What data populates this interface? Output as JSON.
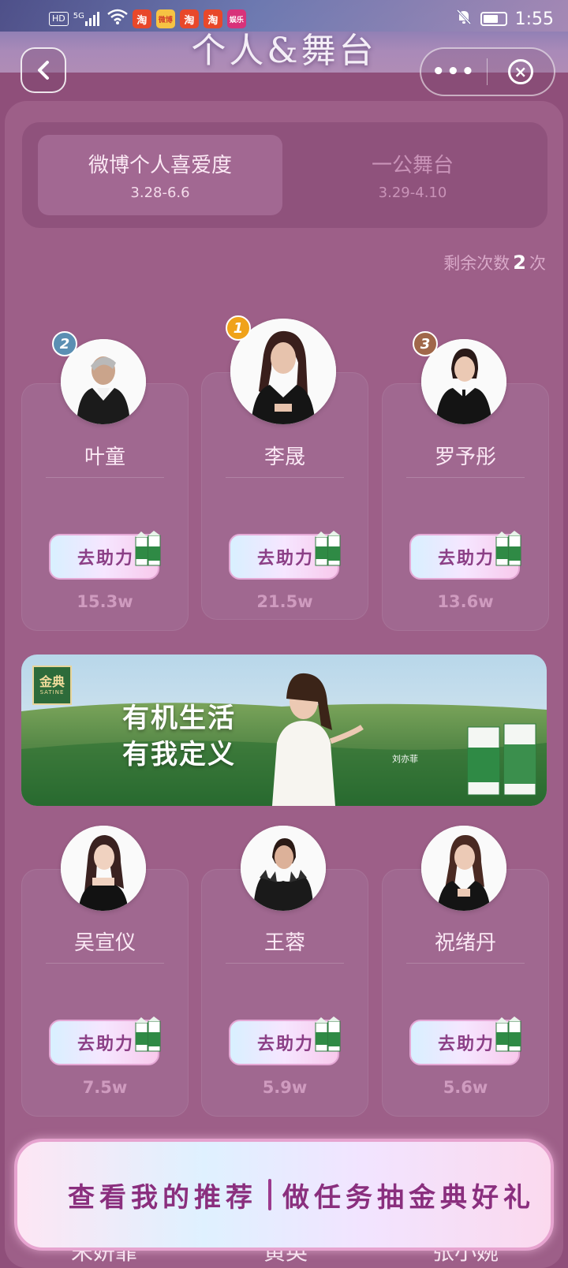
{
  "status_bar": {
    "network_chip": "HD",
    "signal": "5G",
    "time": "1:55",
    "apps": [
      "淘",
      "微博",
      "淘",
      "淘",
      "娱乐"
    ]
  },
  "header": {
    "banner_title": "个人&舞台"
  },
  "tabs": [
    {
      "label": "微博个人喜爱度",
      "dates": "3.28-6.6",
      "active": true
    },
    {
      "label": "一公舞台",
      "dates": "3.29-4.10",
      "active": false
    }
  ],
  "remaining": {
    "prefix": "剩余次数",
    "count": "2",
    "suffix": "次"
  },
  "boost_label": "去助力",
  "contestants_row1": [
    {
      "rank": "2",
      "name": "叶童",
      "votes": "15.3w",
      "rank_color": "#5b8fb3"
    },
    {
      "rank": "1",
      "name": "李晟",
      "votes": "21.5w",
      "rank_color": "#f0a21a"
    },
    {
      "rank": "3",
      "name": "罗予彤",
      "votes": "13.6w",
      "rank_color": "#a0674a"
    }
  ],
  "contestants_row2": [
    {
      "name": "吴宣仪",
      "votes": "7.5w"
    },
    {
      "name": "王蓉",
      "votes": "5.9w"
    },
    {
      "name": "祝绪丹",
      "votes": "5.6w"
    }
  ],
  "ad": {
    "brand": "金典",
    "brand_en": "SATINE",
    "slogan_line1": "有机生活",
    "slogan_line2": "有我定义",
    "signature": "刘亦菲"
  },
  "bottom_cta": {
    "left": "查看我的推荐",
    "right": "做任务抽金典好礼"
  },
  "partial_names": [
    "宋妍霏",
    "黄英",
    "张小婉"
  ]
}
